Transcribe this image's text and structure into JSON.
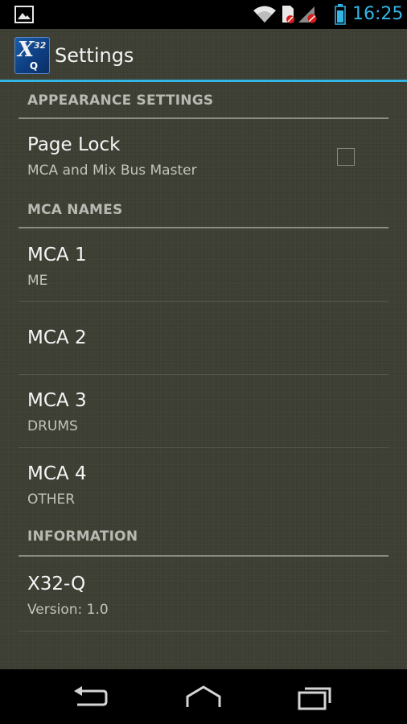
{
  "status_bar": {
    "time": "16:25",
    "icons": [
      "gallery-icon",
      "wifi-icon",
      "sd-card-icon",
      "signal-icon",
      "battery-icon"
    ],
    "accent_color": "#33b5e5"
  },
  "action_bar": {
    "title": "Settings",
    "logo": {
      "main": "X",
      "number": "32",
      "sub": "Q"
    }
  },
  "sections": {
    "appearance": {
      "header": "APPEARANCE SETTINGS",
      "page_lock": {
        "title": "Page Lock",
        "summary": "MCA and Mix Bus Master",
        "checked": false
      }
    },
    "mca_names": {
      "header": "MCA NAMES",
      "items": [
        {
          "title": "MCA 1",
          "summary": "ME"
        },
        {
          "title": "MCA 2",
          "summary": ""
        },
        {
          "title": "MCA 3",
          "summary": "DRUMS"
        },
        {
          "title": "MCA 4",
          "summary": "OTHER"
        }
      ]
    },
    "information": {
      "header": "INFORMATION",
      "app": {
        "title": "X32-Q",
        "summary": "Version: 1.0"
      }
    }
  },
  "nav_bar": {
    "buttons": [
      "back-icon",
      "home-icon",
      "recent-apps-icon"
    ]
  }
}
